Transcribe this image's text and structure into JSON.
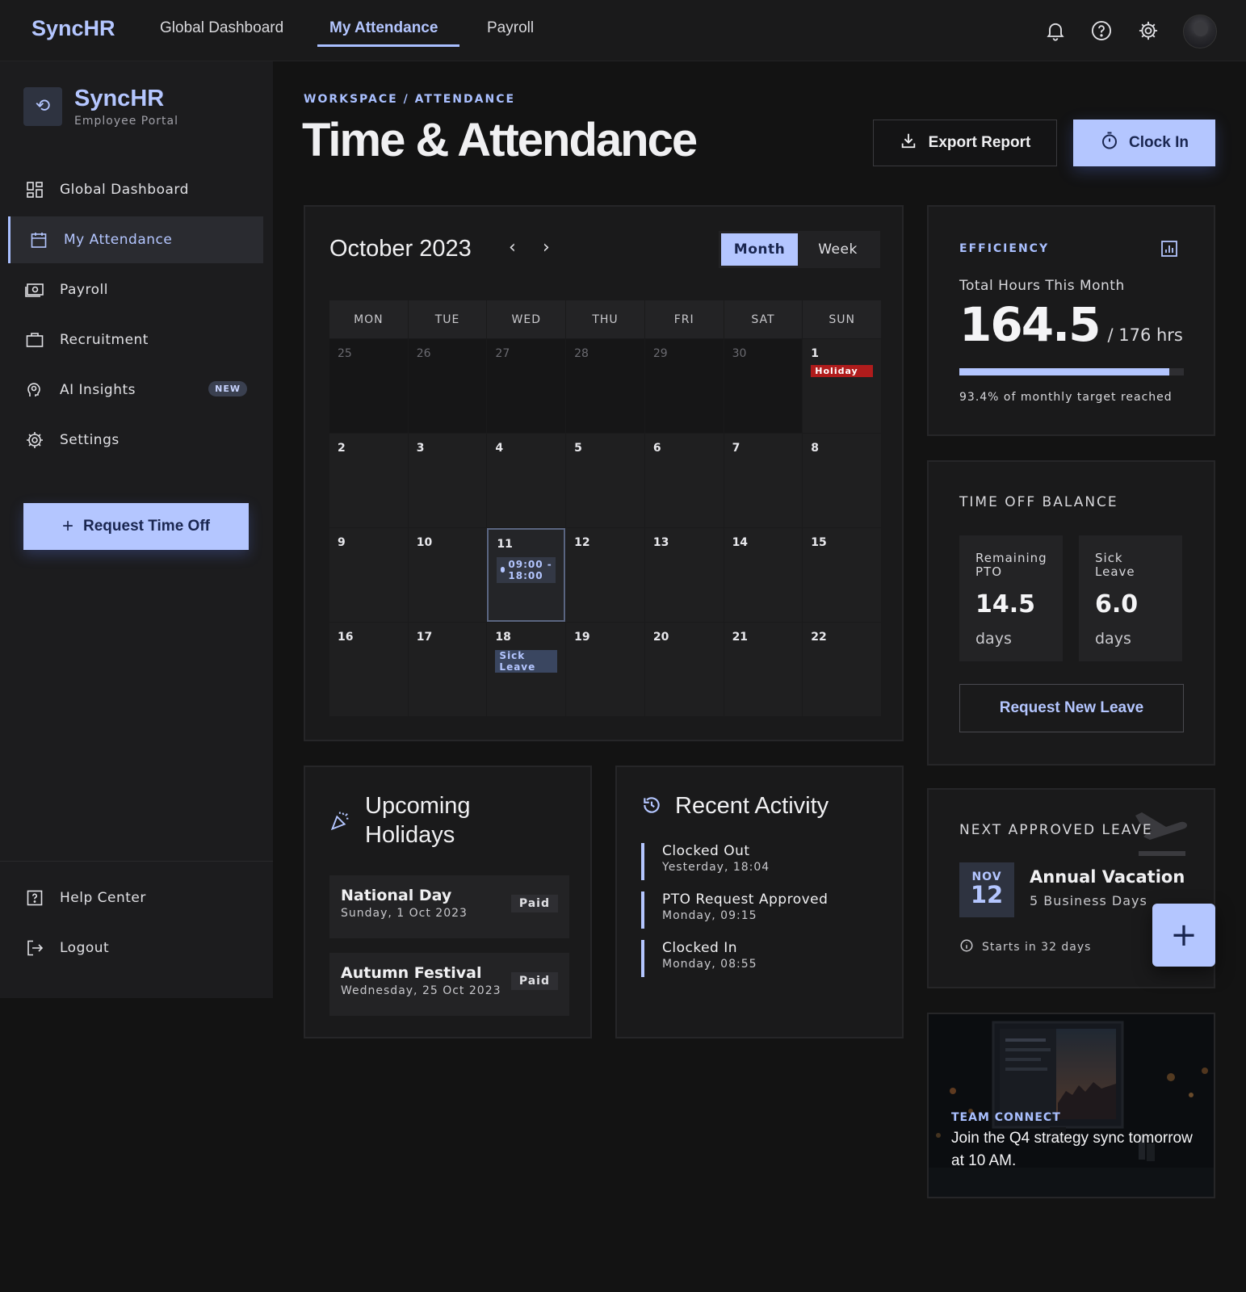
{
  "topbar": {
    "brand": "SyncHR",
    "nav": [
      "Global Dashboard",
      "My Attendance",
      "Payroll"
    ],
    "active_nav": "My Attendance"
  },
  "sidebar": {
    "title": "SyncHR",
    "subtitle": "Employee Portal",
    "items": [
      {
        "label": "Global Dashboard",
        "icon": "dashboard-icon"
      },
      {
        "label": "My Attendance",
        "icon": "calendar-icon",
        "active": true
      },
      {
        "label": "Payroll",
        "icon": "payroll-icon"
      },
      {
        "label": "Recruitment",
        "icon": "briefcase-icon"
      },
      {
        "label": "AI Insights",
        "icon": "ai-insights-icon",
        "badge": "NEW"
      },
      {
        "label": "Settings",
        "icon": "gear-icon"
      }
    ],
    "cta": "Request Time Off",
    "footer": [
      "Help Center",
      "Logout"
    ]
  },
  "header": {
    "breadcrumb": "WORKSPACE / ATTENDANCE",
    "title": "Time & Attendance",
    "export_label": "Export Report",
    "clock_in_label": "Clock In"
  },
  "calendar": {
    "month": "October 2023",
    "views": [
      "Month",
      "Week"
    ],
    "active_view": "Month",
    "weekdays": [
      "MON",
      "TUE",
      "WED",
      "THU",
      "FRI",
      "SAT",
      "SUN"
    ],
    "prev_days": [
      "25",
      "26",
      "27",
      "28",
      "29",
      "30"
    ],
    "days": [
      "1",
      "2",
      "3",
      "4",
      "5",
      "6",
      "7",
      "8",
      "9",
      "10",
      "11",
      "12",
      "13",
      "14",
      "15",
      "16",
      "17",
      "18",
      "19",
      "20",
      "21",
      "22"
    ],
    "holiday_tag": "Holiday",
    "shift_tag": "09:00 - 18:00",
    "sick_tag": "Sick Leave",
    "today": "11"
  },
  "efficiency": {
    "label": "EFFICIENCY",
    "caption": "Total Hours This Month",
    "hours": "164.5",
    "target": "/ 176 hrs",
    "progress_pct": 93.4,
    "note": "93.4% of monthly target reached"
  },
  "time_off": {
    "label": "TIME OFF BALANCE",
    "pto_label": "Remaining PTO",
    "pto_value": "14.5",
    "pto_unit": "days",
    "sick_label": "Sick Leave",
    "sick_value": "6.0",
    "sick_unit": "days",
    "button": "Request New Leave"
  },
  "next_leave": {
    "label": "NEXT APPROVED LEAVE",
    "month": "NOV",
    "day": "12",
    "title": "Annual Vacation",
    "duration": "5 Business Days",
    "starts": "Starts in 32 days"
  },
  "team_connect": {
    "label": "TEAM CONNECT",
    "text": "Join the Q4 strategy sync tomorrow at 10 AM."
  },
  "holidays": {
    "title": "Upcoming Holidays",
    "items": [
      {
        "name": "National Day",
        "date": "Sunday, 1 Oct 2023",
        "tag": "Paid"
      },
      {
        "name": "Autumn Festival",
        "date": "Wednesday, 25 Oct 2023",
        "tag": "Paid"
      }
    ]
  },
  "activity": {
    "title": "Recent Activity",
    "items": [
      {
        "name": "Clocked Out",
        "time": "Yesterday, 18:04"
      },
      {
        "name": "PTO Request Approved",
        "time": "Monday, 09:15"
      },
      {
        "name": "Clocked In",
        "time": "Monday, 08:55"
      }
    ]
  },
  "colors": {
    "accent": "#b4c6ff",
    "holiday": "#b01c1c",
    "bg": "#131313"
  }
}
